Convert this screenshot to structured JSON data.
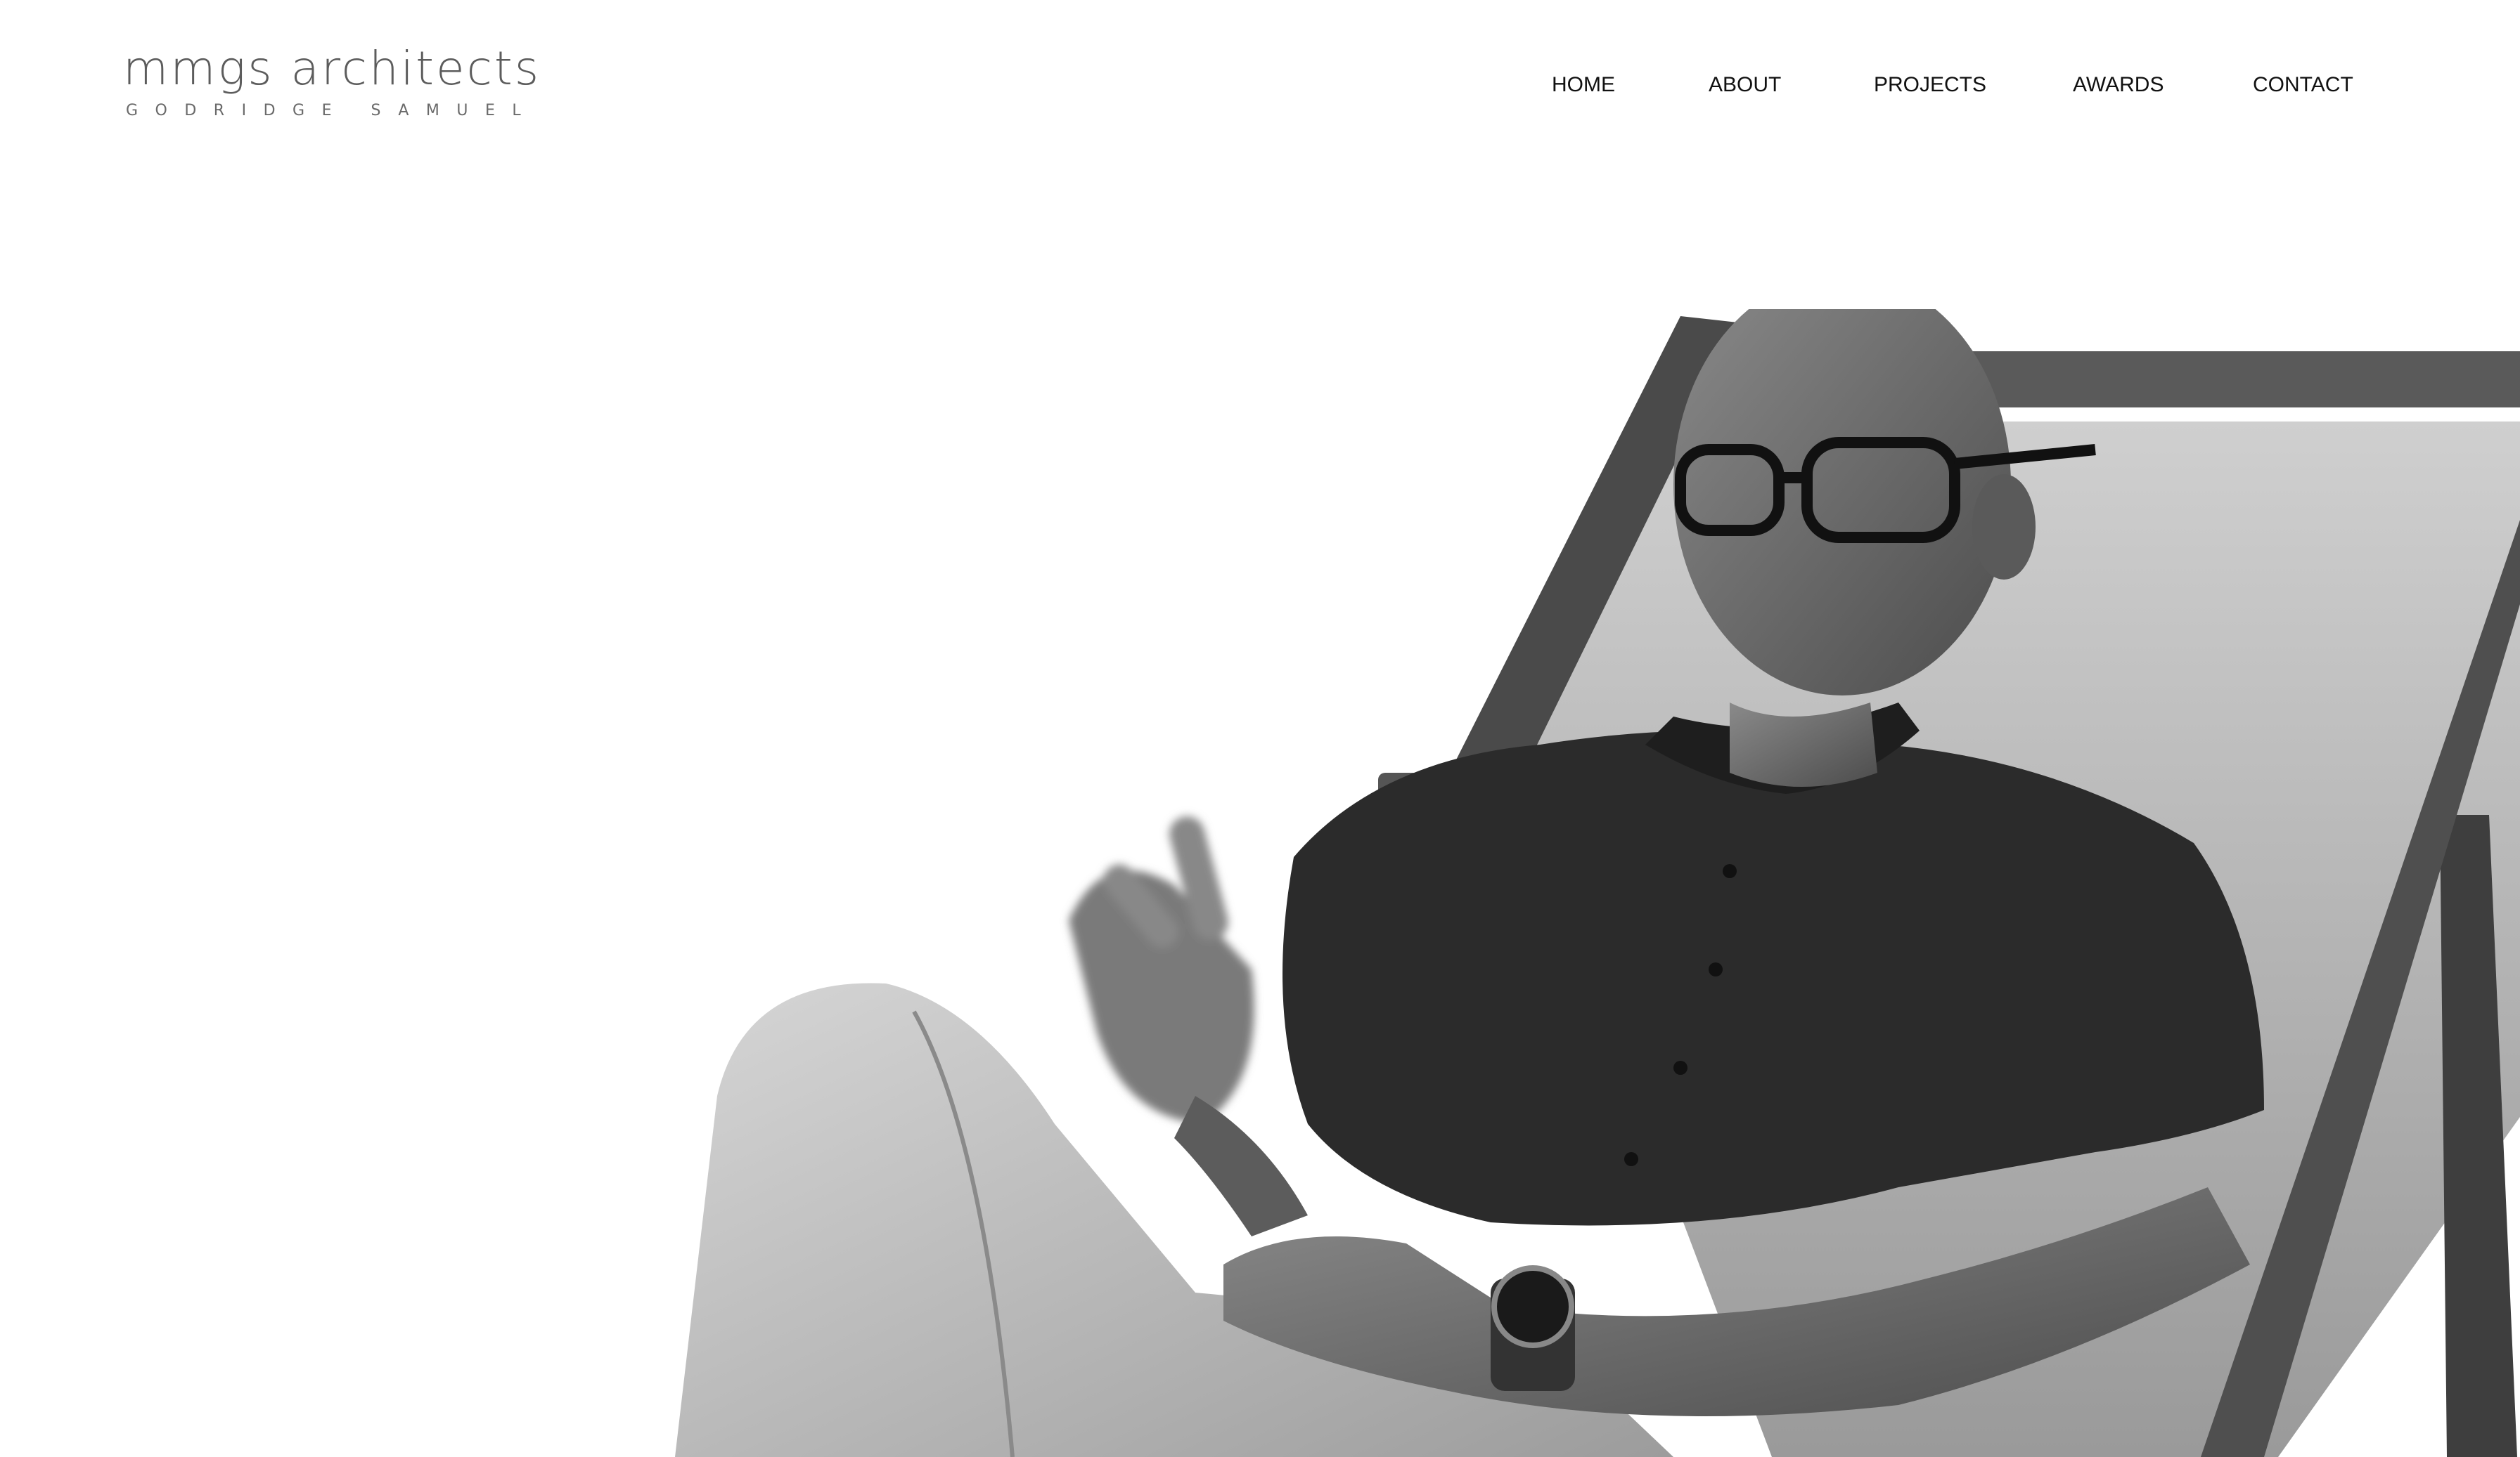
{
  "brand": {
    "name": "mmgs architects",
    "tagline": "GODRIDGE SAMUEL"
  },
  "nav": {
    "items": [
      {
        "label": "HOME"
      },
      {
        "label": "ABOUT"
      },
      {
        "label": "PROJECTS"
      },
      {
        "label": "AWARDS"
      },
      {
        "label": "CONTACT"
      }
    ]
  },
  "hero": {
    "image": "black-and-white-portrait",
    "palette": {
      "background": "#ffffff",
      "shirt": "#2b2b2b",
      "trousers": "#bdbdbd",
      "skin": "#6e6e6e",
      "chair_frame": "#4a4a4a",
      "chair_fabric": "#c4c4c4"
    }
  },
  "colors": {
    "logo": "#5c5c5c",
    "nav_text": "#111111",
    "background": "#ffffff"
  }
}
